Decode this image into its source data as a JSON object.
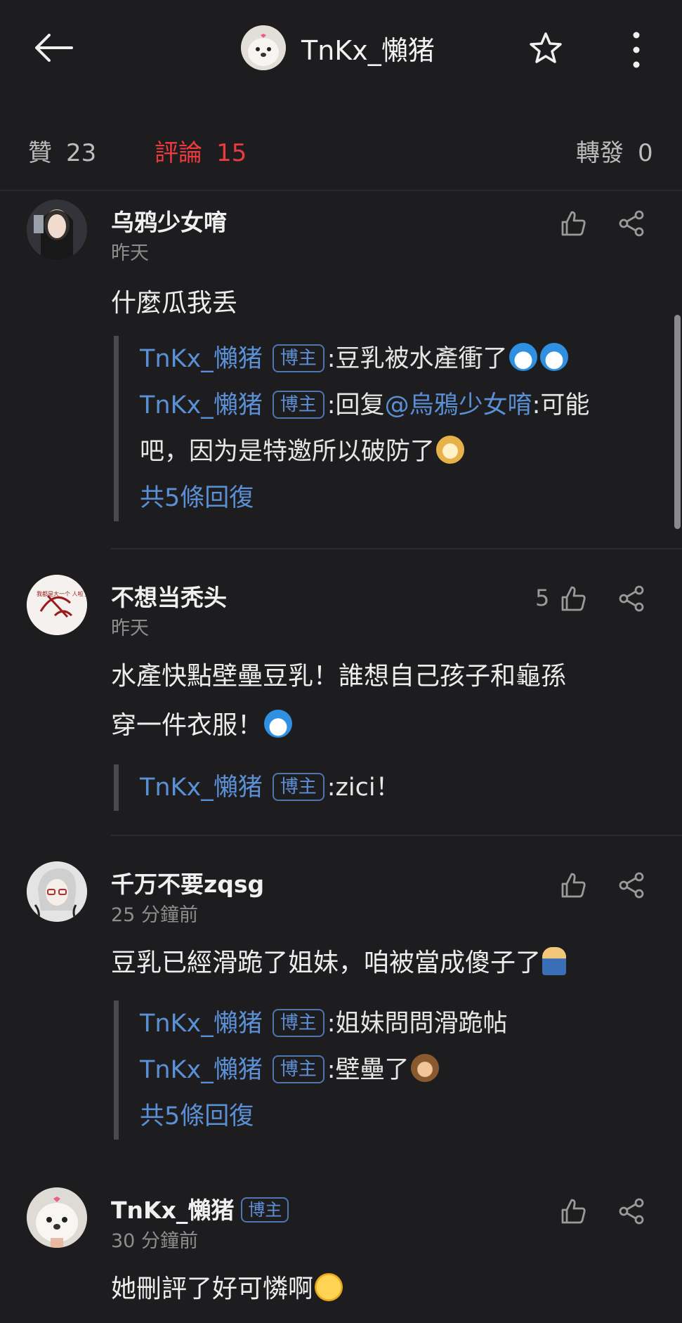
{
  "header": {
    "back_icon": "arrow-left-icon",
    "title": "TnKx_懶猪",
    "star_icon": "star-outline-icon",
    "more_icon": "more-vertical-icon"
  },
  "tabs": [
    {
      "label": "贊",
      "count": "23"
    },
    {
      "label": "評論",
      "count": "15"
    },
    {
      "label": "轉發",
      "count": "0"
    }
  ],
  "colors": {
    "active_tab": "#ec3b3f",
    "link": "#5b8fd6",
    "background": "#1d1d1f"
  },
  "comments": [
    {
      "author": "乌鸦少女唷",
      "time": "昨天",
      "text": "什麼瓜我丢",
      "likes": "",
      "replies": [
        {
          "author": "TnKx_懶猪",
          "tag": "博主",
          "sep": ":",
          "text": "豆乳被水產衝了"
        },
        {
          "author": "TnKx_懶猪",
          "tag": "博主",
          "sep": ":",
          "text_pre": "回复",
          "mention": "@烏鴉少女唷",
          "text": ":可能"
        },
        {
          "text": "吧，因为是特邀所以破防了"
        }
      ],
      "more_replies": "共5條回復"
    },
    {
      "author": "不想当秃头",
      "time": "昨天",
      "text_line1": "水產快點壁壘豆乳！誰想自己孩子和龜孫",
      "text_line2": "穿一件衣服！",
      "likes": "5",
      "avatar_text": "我都是大一个 人啦了?",
      "replies": [
        {
          "author": "TnKx_懶猪",
          "tag": "博主",
          "sep": ":",
          "text": "zici！"
        }
      ]
    },
    {
      "author": "千万不要zqsg",
      "time": "25 分鐘前",
      "text": "豆乳已經滑跪了姐妹，咱被當成傻子了",
      "likes": "",
      "replies": [
        {
          "author": "TnKx_懶猪",
          "tag": "博主",
          "sep": ":",
          "text": "姐妹問問滑跪帖"
        },
        {
          "author": "TnKx_懶猪",
          "tag": "博主",
          "sep": ":",
          "text": "壁壘了"
        }
      ],
      "more_replies": "共5條回復"
    },
    {
      "author": "TnKx_懶猪",
      "author_tag": "博主",
      "time": "30 分鐘前",
      "text": "她刪評了好可憐啊",
      "likes": ""
    }
  ]
}
